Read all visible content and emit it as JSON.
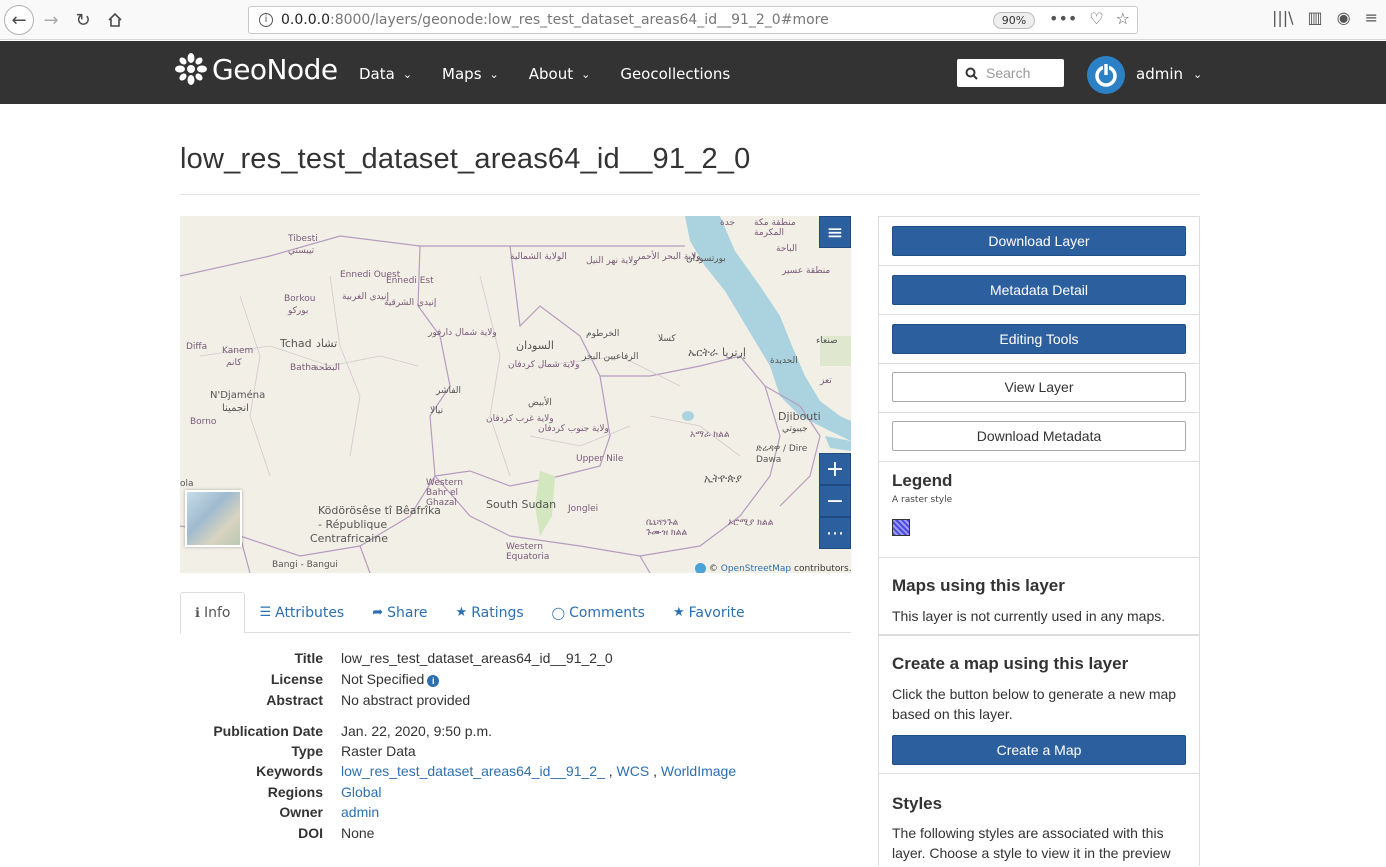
{
  "browser": {
    "url_host": "0.0.0.0",
    "url_rest": ":8000/layers/geonode:low_res_test_dataset_areas64_id__91_2_0#more",
    "zoom": "90%"
  },
  "navbar": {
    "brand": "GeoNode",
    "menu": [
      {
        "label": "Data",
        "caret": true
      },
      {
        "label": "Maps",
        "caret": true
      },
      {
        "label": "About",
        "caret": true
      },
      {
        "label": "Geocollections",
        "caret": false
      }
    ],
    "search_placeholder": "Search",
    "user": "admin"
  },
  "page": {
    "title": "low_res_test_dataset_areas64_id__91_2_0"
  },
  "map": {
    "labels": [
      {
        "text": "Tibesti",
        "cls": ""
      },
      {
        "text": "تيبستي",
        "cls": ""
      },
      {
        "text": "Ennedi Ouest",
        "cls": ""
      },
      {
        "text": "إنيدي الغربية",
        "cls": ""
      },
      {
        "text": "Ennedi Est",
        "cls": ""
      },
      {
        "text": "إنيدي الشرقية",
        "cls": ""
      },
      {
        "text": "Borkou",
        "cls": ""
      },
      {
        "text": "بوركو",
        "cls": ""
      },
      {
        "text": "Tchad",
        "cls": "country"
      },
      {
        "text": "تشاد",
        "cls": "country"
      },
      {
        "text": "Kanem",
        "cls": ""
      },
      {
        "text": "كانم",
        "cls": ""
      },
      {
        "text": "Diffa",
        "cls": ""
      },
      {
        "text": "Batha",
        "cls": ""
      },
      {
        "text": "البطحة",
        "cls": ""
      },
      {
        "text": "N'Djaména",
        "cls": "country"
      },
      {
        "text": "انجمينا",
        "cls": "country"
      },
      {
        "text": "Borno",
        "cls": ""
      },
      {
        "text": "الولاية الشمالية",
        "cls": ""
      },
      {
        "text": "ولاية نهر النيل",
        "cls": ""
      },
      {
        "text": "ولاية البحر الأحمر",
        "cls": ""
      },
      {
        "text": "بورتسودان",
        "cls": "country"
      },
      {
        "text": "ولاية شمال دارفور",
        "cls": ""
      },
      {
        "text": "السودان",
        "cls": "country"
      },
      {
        "text": "الخرطوم",
        "cls": "country"
      },
      {
        "text": "الرفاعيين البحر",
        "cls": "country"
      },
      {
        "text": "كسلا",
        "cls": "country"
      },
      {
        "text": "ولاية شمال كردفان",
        "cls": ""
      },
      {
        "text": "الفاشر",
        "cls": "country"
      },
      {
        "text": "نيالا",
        "cls": "country"
      },
      {
        "text": "الأبيض",
        "cls": "country"
      },
      {
        "text": "ولاية غرب كردفان",
        "cls": ""
      },
      {
        "text": "ولاية جنوب كردفان",
        "cls": ""
      },
      {
        "text": "Upper Nile",
        "cls": ""
      },
      {
        "text": "ኤርትራ",
        "cls": "country"
      },
      {
        "text": "إرتريا",
        "cls": "country"
      },
      {
        "text": "الحديدة",
        "cls": "country"
      },
      {
        "text": "صنعاء",
        "cls": "country"
      },
      {
        "text": "Djibouti",
        "cls": "country"
      },
      {
        "text": "جيبوتي",
        "cls": "country"
      },
      {
        "text": "ድሬዳዋ / Dire Dawa",
        "cls": "country"
      },
      {
        "text": "አማራ ክልል",
        "cls": ""
      },
      {
        "text": "ኢትዮጵያ",
        "cls": "country"
      },
      {
        "text": "Western Bahr el Ghazal",
        "cls": ""
      },
      {
        "text": "South Sudan",
        "cls": "country"
      },
      {
        "text": "Jonglei",
        "cls": ""
      },
      {
        "text": "Ködörösêse tî Bêafrîka",
        "cls": "country"
      },
      {
        "text": "- République",
        "cls": "country"
      },
      {
        "text": "Centrafricaine",
        "cls": "country"
      },
      {
        "text": "Western Equatoria",
        "cls": ""
      },
      {
        "text": "Bangi - Bangui",
        "cls": "country"
      },
      {
        "text": "ኦሮሚያ ክልል",
        "cls": ""
      },
      {
        "text": "ቤኒሻንጉል ጉሙዝ ክልል",
        "cls": ""
      },
      {
        "text": "منطقة مكة المكرمة",
        "cls": ""
      },
      {
        "text": "جدة",
        "cls": ""
      },
      {
        "text": "الباحة",
        "cls": ""
      },
      {
        "text": "منطقة عسير",
        "cls": ""
      },
      {
        "text": "تعز",
        "cls": ""
      },
      {
        "text": "ola",
        "cls": "country"
      }
    ],
    "zoom_in": "+",
    "zoom_out": "−",
    "more": "⋯",
    "layers_icon": "≡",
    "attribution_prefix": "©",
    "attribution_link": "OpenStreetMap",
    "attribution_suffix": "contributors."
  },
  "tabs": [
    {
      "label": "Info",
      "icon": "ℹ",
      "active": true
    },
    {
      "label": "Attributes",
      "icon": "☰",
      "active": false
    },
    {
      "label": "Share",
      "icon": "➦",
      "active": false
    },
    {
      "label": "Ratings",
      "icon": "★",
      "active": false
    },
    {
      "label": "Comments",
      "icon": "💬",
      "active": false
    },
    {
      "label": "Favorite",
      "icon": "★",
      "active": false
    }
  ],
  "info": {
    "title_k": "Title",
    "title_v": "low_res_test_dataset_areas64_id__91_2_0",
    "license_k": "License",
    "license_v": "Not Specified",
    "abstract_k": "Abstract",
    "abstract_v": "No abstract provided",
    "pubdate_k": "Publication Date",
    "pubdate_v": "Jan. 22, 2020, 9:50 p.m.",
    "type_k": "Type",
    "type_v": "Raster Data",
    "keywords_k": "Keywords",
    "keywords": [
      "low_res_test_dataset_areas64_id__91_2_",
      "WCS",
      "WorldImage"
    ],
    "regions_k": "Regions",
    "regions_v": "Global",
    "owner_k": "Owner",
    "owner_v": "admin",
    "doi_k": "DOI",
    "doi_v": "None"
  },
  "sidebar": {
    "download_layer": "Download Layer",
    "metadata_detail": "Metadata Detail",
    "editing_tools": "Editing Tools",
    "view_layer": "View Layer",
    "download_metadata": "Download Metadata",
    "legend_title": "Legend",
    "legend_sub": "A raster style",
    "maps_title": "Maps using this layer",
    "maps_text": "This layer is not currently used in any maps.",
    "create_title": "Create a map using this layer",
    "create_text": "Click the button below to generate a new map based on this layer.",
    "create_button": "Create a Map",
    "styles_title": "Styles",
    "styles_text": "The following styles are associated with this layer. Choose a style to view it in the preview"
  }
}
